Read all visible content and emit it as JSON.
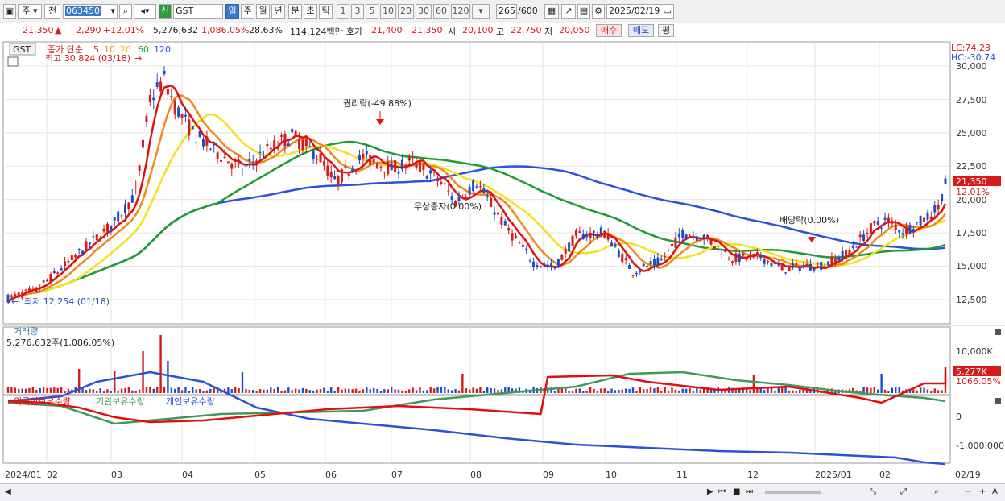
{
  "toolbar": {
    "period_buttons": [
      "주",
      "전"
    ],
    "code": "063450",
    "name": "GST",
    "new_badge": "신",
    "interval_tabs": [
      "일",
      "주",
      "월",
      "년",
      "분",
      "초",
      "틱"
    ],
    "minute_buttons": [
      "1",
      "3",
      "5",
      "10",
      "20",
      "30",
      "60",
      "120"
    ],
    "count": "265",
    "count_total": "/600",
    "date": "2025/02/19"
  },
  "info": {
    "price": "21,350",
    "change": "2,290",
    "change_pct": "+12.01%",
    "volume": "5,276,632",
    "volume_pct": "1,086.05%",
    "turnover_pct": "28.63%",
    "amount": "114,124백만",
    "hoga_label": "호가",
    "ask": "21,400",
    "bid": "21,350",
    "open_label": "시",
    "open": "20,100",
    "high_label": "고",
    "high": "22,750",
    "low_label": "저",
    "low": "20,050",
    "buy": "매수",
    "sell": "매도",
    "avg": "평"
  },
  "price_panel": {
    "symbol": "GST",
    "ma_title": "종가 단순",
    "ma_periods": [
      "5",
      "10",
      "20",
      "60",
      "120"
    ],
    "high_label": "최고 30,824 (03/18)",
    "low_label": "최저 12,254 (01/18)",
    "lc": "LC:74.23",
    "hc": "HC:-30.74",
    "y_ticks": [
      "30,000",
      "27,500",
      "25,000",
      "22,500",
      "20,000",
      "17,500",
      "15,000",
      "12,500"
    ],
    "last_price": "21,350",
    "last_pct": "12.01%",
    "events": [
      "권리락(-49.88%)",
      "무상증자(0.00%)",
      "배당락(0.00%)"
    ]
  },
  "volume_panel": {
    "title": "거래량",
    "value": "5,276,632주(1,086.05%)",
    "y_tick": "10,000K",
    "last": "5,277K",
    "last_pct": "1066.05%"
  },
  "holding_panel": {
    "series": [
      "외국인보유수량",
      "기관보유수량",
      "개인보유수량"
    ],
    "y_ticks": [
      "0",
      "-1,000,000"
    ]
  },
  "x_axis": [
    "2024/01",
    "02",
    "03",
    "04",
    "05",
    "06",
    "07",
    "08",
    "09",
    "10",
    "11",
    "12",
    "2025/01",
    "02",
    "02/19"
  ],
  "colors": {
    "ma5": "#e01010",
    "ma10": "#f08a1a",
    "ma20": "#f2e21a",
    "ma60": "#1e9a36",
    "ma120": "#2b52d8",
    "up": "#d71a1a",
    "down": "#1d4fc4",
    "foreign": "#e01010",
    "institution": "#3f9a5a",
    "individual": "#2b52d8"
  }
}
